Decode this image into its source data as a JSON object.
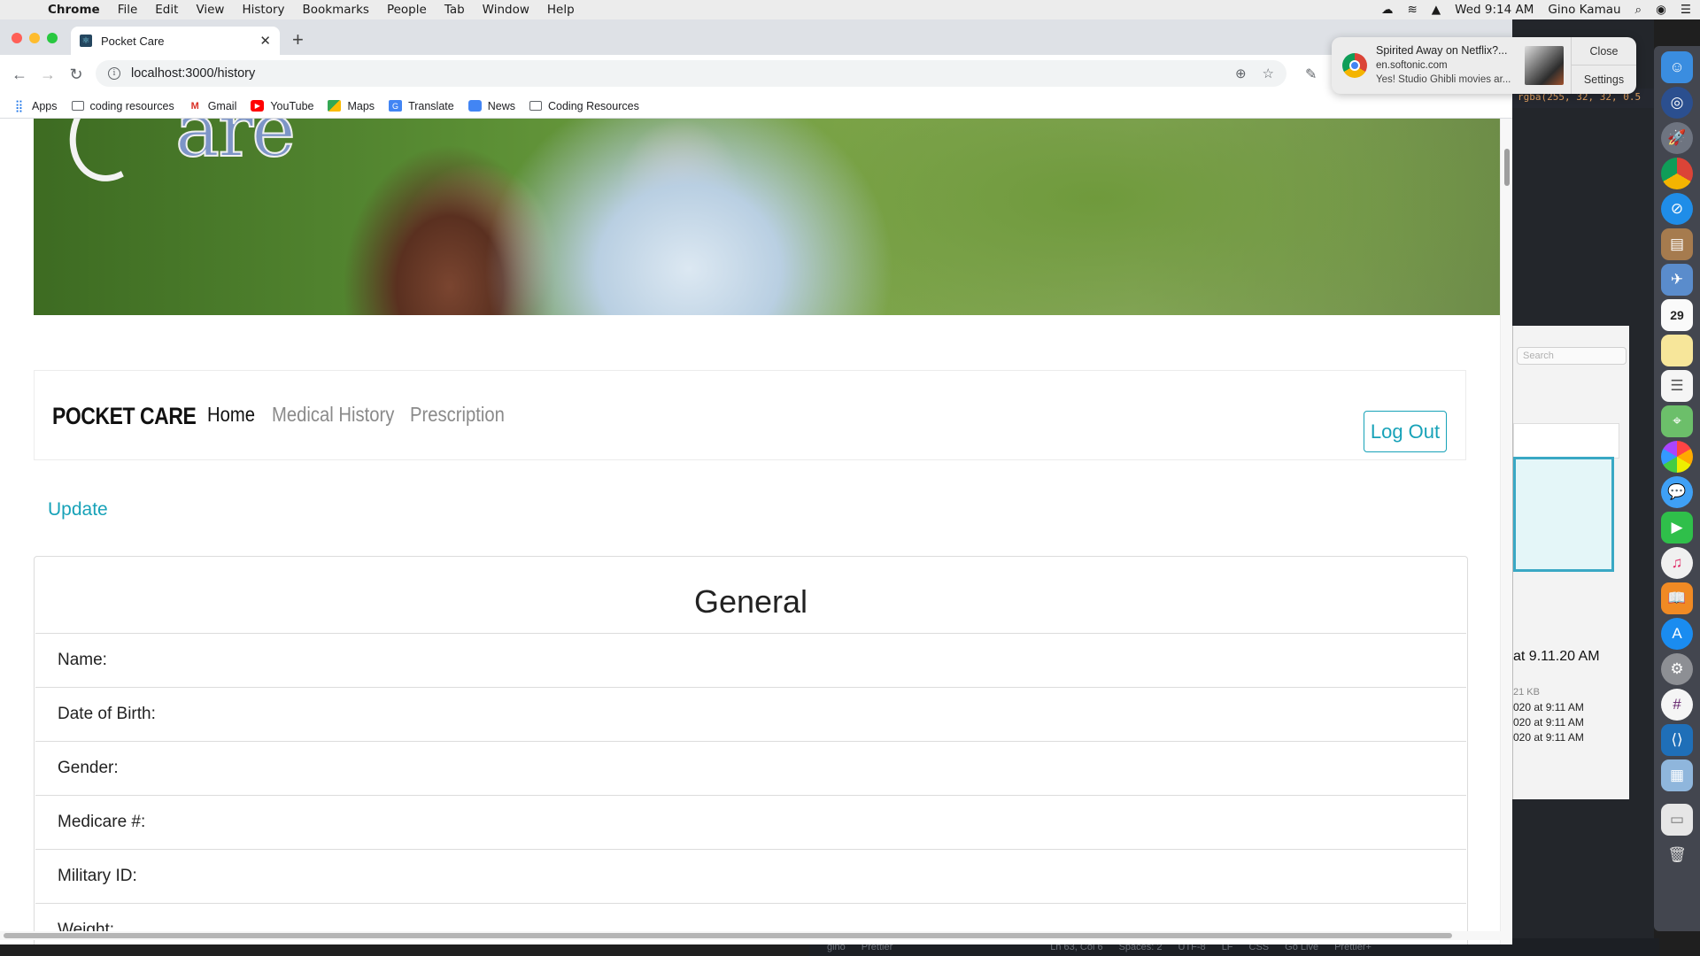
{
  "menubar": {
    "app": "Chrome",
    "items": [
      "File",
      "Edit",
      "View",
      "History",
      "Bookmarks",
      "People",
      "Tab",
      "Window",
      "Help"
    ],
    "datetime": "Wed 9:14 AM",
    "user": "Gino Kamau"
  },
  "browser": {
    "tab_title": "Pocket Care",
    "url": "localhost:3000/history",
    "bookmarks": [
      {
        "label": "Apps",
        "icon": "apps-grid-icon"
      },
      {
        "label": "coding resources",
        "icon": "folder-icon"
      },
      {
        "label": "Gmail",
        "icon": "gmail-icon"
      },
      {
        "label": "YouTube",
        "icon": "youtube-icon"
      },
      {
        "label": "Maps",
        "icon": "maps-icon"
      },
      {
        "label": "Translate",
        "icon": "translate-icon"
      },
      {
        "label": "News",
        "icon": "news-icon"
      },
      {
        "label": "Coding Resources",
        "icon": "folder-icon"
      }
    ]
  },
  "notification": {
    "title": "Spirited Away on Netflix?...",
    "source": "en.softonic.com",
    "body": "Yes! Studio Ghibli movies ar...",
    "close_label": "Close",
    "settings_label": "Settings"
  },
  "page": {
    "navbar": {
      "brand": "POCKET CARE",
      "links": [
        "Home",
        "Medical History",
        "Prescription"
      ],
      "logout_label": "Log Out"
    },
    "update_link": "Update",
    "card": {
      "title": "General",
      "fields": [
        "Name:",
        "Date of Birth:",
        "Gender:",
        "Medicare #:",
        "Military ID:",
        "Weight:"
      ]
    }
  },
  "background": {
    "code_snippet": "rgba(255, 32, 32, 0.5",
    "finder_search_placeholder": "Search",
    "finder_title": "at 9.11.20 AM",
    "finder_size": "21 KB",
    "finder_dates": [
      "020 at 9:11 AM",
      "020 at 9:11 AM",
      "020 at 9:11 AM"
    ],
    "status_items": [
      "gino",
      "Prettier",
      "Ln 63, Col 6",
      "Spaces: 2",
      "UTF-8",
      "LF",
      "CSS",
      "Go Live",
      "Prettier+"
    ],
    "dock_calendar_day": "29"
  },
  "colors": {
    "accent": "#17a2b8",
    "nav_muted": "#8a8a8a",
    "tab_strip": "#dee1e6"
  }
}
